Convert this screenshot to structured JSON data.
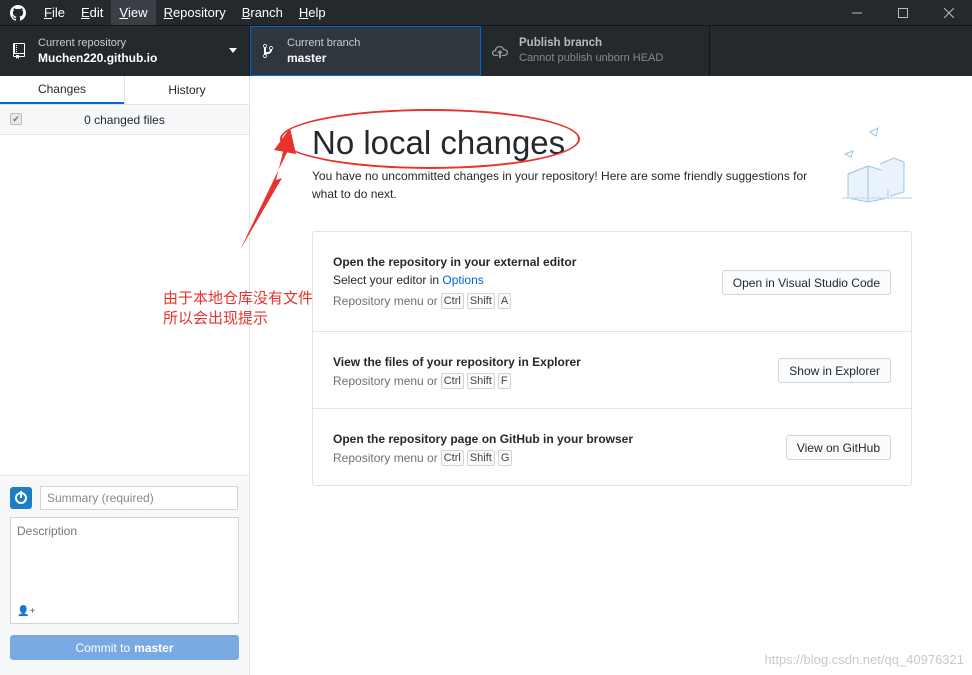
{
  "menubar": {
    "items": [
      {
        "prefix": "",
        "underline": "F",
        "rest": "ile"
      },
      {
        "prefix": "",
        "underline": "E",
        "rest": "dit"
      },
      {
        "prefix": "",
        "underline": "V",
        "rest": "iew"
      },
      {
        "prefix": "",
        "underline": "R",
        "rest": "epository"
      },
      {
        "prefix": "",
        "underline": "B",
        "rest": "ranch"
      },
      {
        "prefix": "",
        "underline": "H",
        "rest": "elp"
      }
    ],
    "active_index": 2
  },
  "toolbar": {
    "repo_label": "Current repository",
    "repo_value": "Muchen220.github.io",
    "branch_label": "Current branch",
    "branch_value": "master",
    "publish_label": "Publish branch",
    "publish_value": "Cannot publish unborn HEAD"
  },
  "sidebar": {
    "tabs": [
      "Changes",
      "History"
    ],
    "changes_count": "0 changed files",
    "summary_placeholder": "Summary (required)",
    "description_placeholder": "Description",
    "commit_prefix": "Commit to",
    "commit_branch": "master"
  },
  "main": {
    "title": "No local changes",
    "subtitle": "You have no uncommitted changes in your repository! Here are some friendly suggestions for what to do next.",
    "suggestions": [
      {
        "title": "Open the repository in your external editor",
        "sub_prefix": "Select your editor in",
        "sub_link": "Options",
        "shortcut_prefix": "Repository menu or",
        "keys": [
          "Ctrl",
          "Shift",
          "A"
        ],
        "button": "Open in Visual Studio Code"
      },
      {
        "title": "View the files of your repository in Explorer",
        "shortcut_prefix": "Repository menu or",
        "keys": [
          "Ctrl",
          "Shift",
          "F"
        ],
        "button": "Show in Explorer"
      },
      {
        "title": "Open the repository page on GitHub in your browser",
        "shortcut_prefix": "Repository menu or",
        "keys": [
          "Ctrl",
          "Shift",
          "G"
        ],
        "button": "View on GitHub"
      }
    ]
  },
  "annotation": {
    "line1": "由于本地仓库没有文件",
    "line2": "所以会出现提示",
    "color": "#e8322e"
  },
  "watermark": "https://blog.csdn.net/qq_40976321",
  "colors": {
    "accent": "#0366d6",
    "titlebar": "#24292e",
    "commit_button": "#79a9e3"
  }
}
